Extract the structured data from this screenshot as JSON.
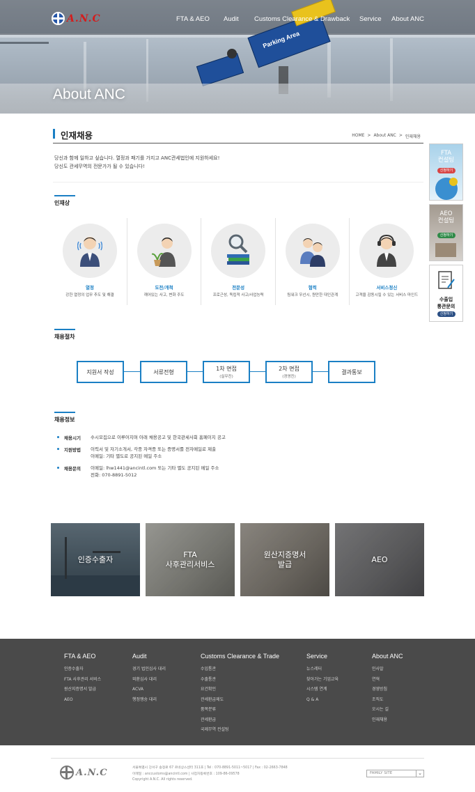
{
  "header": {
    "logo_text": "A.N.C",
    "nav": [
      "FTA & AEO",
      "Audit",
      "Customs Clearance & Drawback",
      "Service",
      "About ANC"
    ],
    "hero_title": "About ANC",
    "sign_text": "Parking Area"
  },
  "page": {
    "title": "인재채용",
    "breadcrumb": [
      "HOME",
      ">",
      "About ANC",
      ">",
      "인재채용"
    ],
    "intro": [
      "당신과 함께 일하고 싶습니다. 열정과 패기를 가지고 ANC관세법인에 지원하세요!",
      "당신도 관세무역의 전문가가 될 수 있습니다!"
    ]
  },
  "talent": {
    "title": "인재상",
    "items": [
      {
        "name": "열정",
        "desc": "강한 열정의 업무 추도 및 해결"
      },
      {
        "name": "도전/개척",
        "desc": "깨어있는 사고, 변화 주도"
      },
      {
        "name": "전문성",
        "desc": "프로근성, 독립적 사고/사업능력"
      },
      {
        "name": "협력",
        "desc": "팀워크 우선시, 원만한 대인관계"
      },
      {
        "name": "서비스정신",
        "desc": "고객을 감동시킬 수 있는 서비스 마인드"
      }
    ]
  },
  "process": {
    "title": "채용절차",
    "steps": [
      {
        "label": "지원서 작성",
        "sub": ""
      },
      {
        "label": "서류전형",
        "sub": ""
      },
      {
        "label": "1차 면접",
        "sub": "(실무진)"
      },
      {
        "label": "2차 면접",
        "sub": "(경영진)"
      },
      {
        "label": "결과통보",
        "sub": ""
      }
    ]
  },
  "info": {
    "title": "채용정보",
    "rows": [
      {
        "label": "채용시기",
        "lines": [
          "수시모집으로 이루어지며 아래 채용공고 및 한국관세사회 홈페이지 공고"
        ]
      },
      {
        "label": "지원방법",
        "lines": [
          "이력서 및 자기소개서, 각종 자격증 또는 증명서를 전자메일로 제출",
          "이메일: 기타 별도로 공지된 메일 주소"
        ]
      },
      {
        "label": "채용문의",
        "lines": [
          "이메일: lhw1441@ancintl.com 또는 기타 별도 공지된 메일 주소",
          "전화: 070-8891-5012"
        ]
      }
    ]
  },
  "tiles": [
    {
      "label": "인증수출자"
    },
    {
      "label": "FTA\n사후관리서비스"
    },
    {
      "label": "원산지증명서\n발급"
    },
    {
      "label": "AEO"
    }
  ],
  "side": [
    {
      "title": "FTA\n컨설팅",
      "badge": "신청하기"
    },
    {
      "title": "AEO\n컨설팅",
      "badge": "신청하기"
    },
    {
      "title": "수출입\n통관문의",
      "badge": "신청하기"
    }
  ],
  "footer": {
    "columns": [
      {
        "head": "FTA & AEO",
        "items": [
          "인증수출자",
          "FTA 사후관리 서비스",
          "원산지증명서 발급",
          "AEO"
        ]
      },
      {
        "head": "Audit",
        "items": [
          "경기 법인심사 대리",
          "외환심사 대리",
          "ACVA",
          "행정쟁송 대리"
        ]
      },
      {
        "head": "Customs Clearance & Trade",
        "items": [
          "수입통관",
          "수출통관",
          "요건확인",
          "관세환급제도",
          "품목분류",
          "관세환급",
          "국제무역 컨설팅"
        ]
      },
      {
        "head": "Service",
        "items": [
          "뉴스레터",
          "찾아가는 기업교육",
          "시스템 연계",
          "Q & A"
        ]
      },
      {
        "head": "About ANC",
        "items": [
          "인사말",
          "연혁",
          "경영방침",
          "조직도",
          "오시는 길",
          "인재채용"
        ]
      }
    ],
    "address_lines": [
      "서울특별시 강서구 송정로 67 르네상스센터 311호   |   Tel : 070-8891-5011~5017   |   Fax : 02-2663-7848",
      "이메일 : anccustoms@ancintl.com   |   사업자등록번호 : 109-86-09578",
      "Copyright A.N.C. All rights reserved."
    ],
    "family_site": "FAMILY SITE"
  },
  "colors": {
    "accent": "#1a7fc4",
    "footer_bg": "#4a4a4a"
  }
}
